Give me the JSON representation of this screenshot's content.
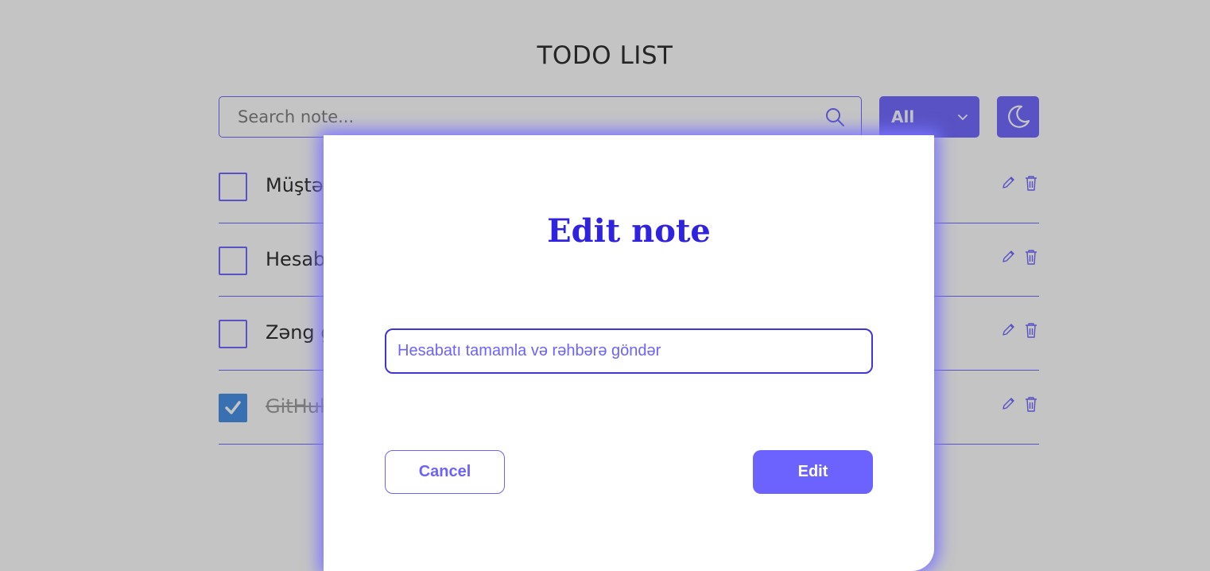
{
  "app": {
    "title": "TODO LIST"
  },
  "toolbar": {
    "search_placeholder": "Search note...",
    "search_icon": "search-icon",
    "filter_selected": "All",
    "filter_icon": "chevron-down-icon",
    "theme_icon": "moon-icon"
  },
  "todos": [
    {
      "text": "Müştə",
      "done": false
    },
    {
      "text": "Hesab",
      "done": false
    },
    {
      "text": "Zəng g",
      "done": false
    },
    {
      "text": "GitHul",
      "done": true
    }
  ],
  "row_icons": {
    "edit": "pencil-icon",
    "delete": "trash-icon"
  },
  "modal": {
    "title": "Edit note",
    "input_value": "Hesabatı tamamla və rəhbərə göndər",
    "cancel_label": "Cancel",
    "edit_label": "Edit"
  },
  "colors": {
    "accent": "#6c63ff",
    "modal_title": "#2f22e0",
    "checkbox_checked": "#3f8ce6",
    "text": "#252525"
  }
}
